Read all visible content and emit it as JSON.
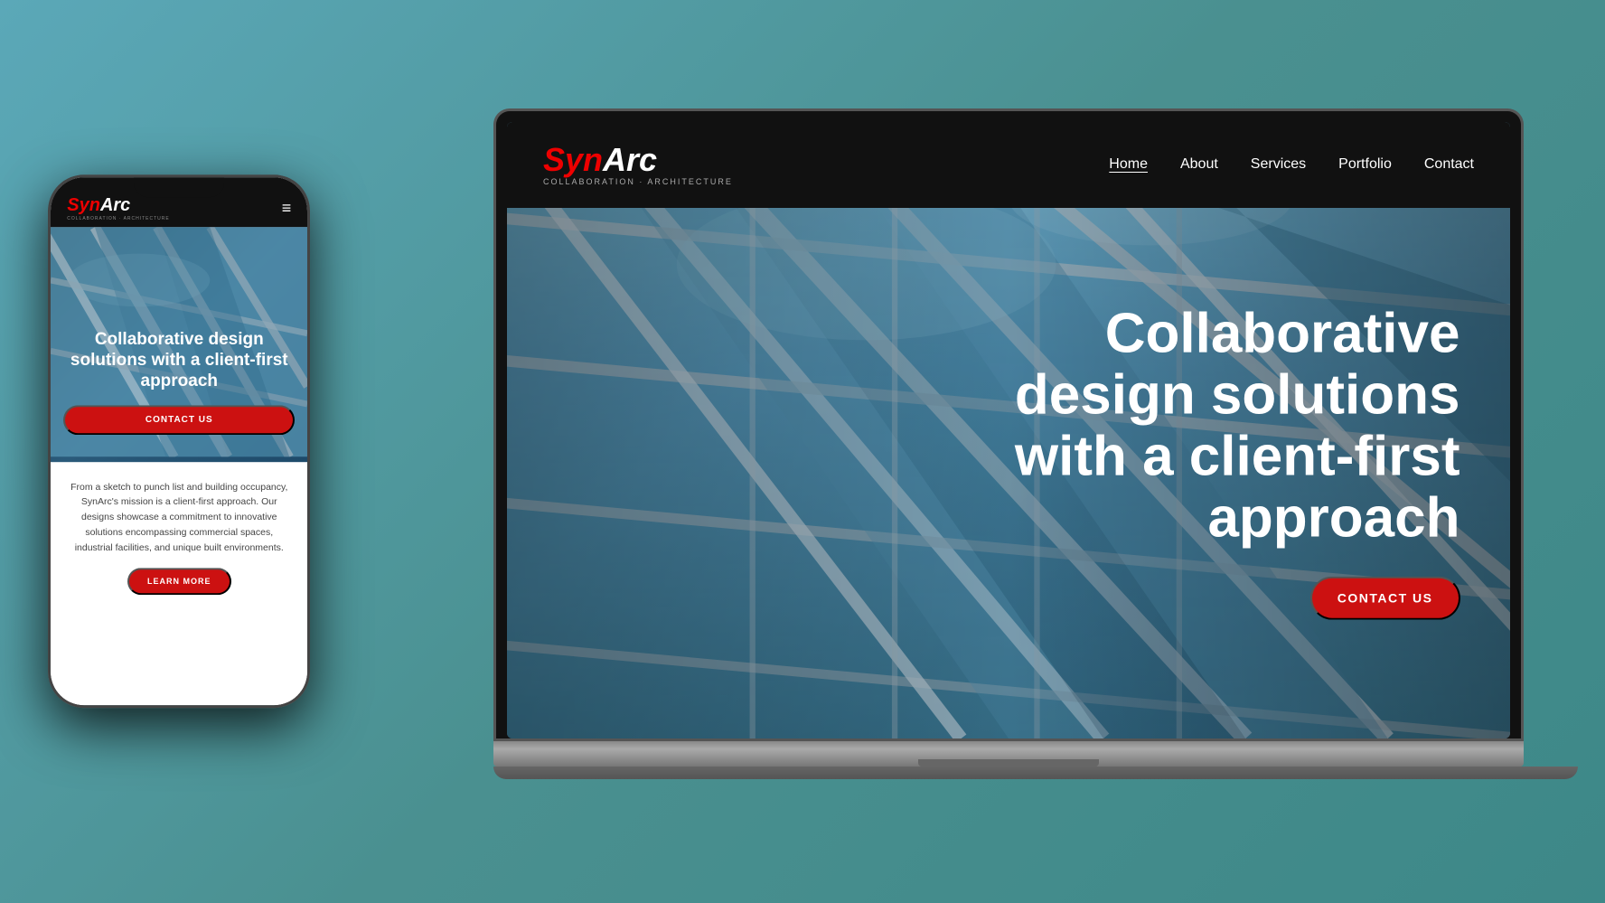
{
  "brand": {
    "syn": "Syn",
    "arc": "Arc",
    "tagline": "COLLABORATION · ARCHITECTURE"
  },
  "desktop": {
    "nav": {
      "links": [
        {
          "label": "Home",
          "active": true
        },
        {
          "label": "About",
          "active": false
        },
        {
          "label": "Services",
          "active": false
        },
        {
          "label": "Portfolio",
          "active": false
        },
        {
          "label": "Contact",
          "active": false
        }
      ]
    },
    "hero": {
      "title": "Collaborative design solutions with a client-first approach",
      "cta": "CONTACT US"
    }
  },
  "mobile": {
    "hero": {
      "title": "Collaborative design solutions with a client-first approach",
      "cta": "CONTACT US"
    },
    "body": {
      "text": "From a sketch to punch list and building occupancy, SynArc's mission is a client-first approach. Our designs showcase a commitment to innovative solutions encompassing commercial spaces, industrial facilities, and unique built environments.",
      "cta": "LEARN MORE"
    }
  },
  "colors": {
    "accent": "#cc1111",
    "dark": "#111111",
    "white": "#ffffff"
  }
}
